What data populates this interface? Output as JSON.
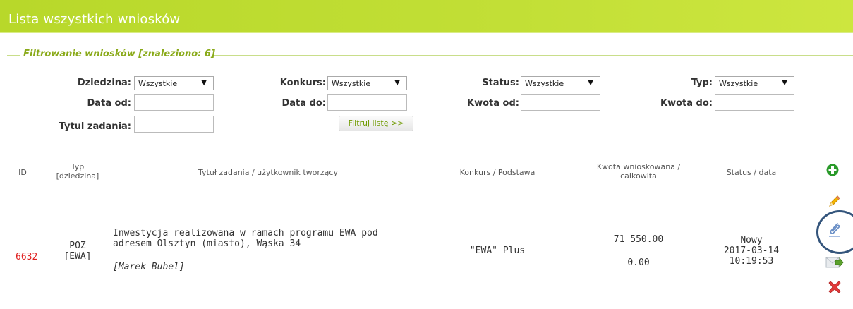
{
  "header": {
    "title": "Lista wszystkich wniosków"
  },
  "filter": {
    "legend": "Filtrowanie wniosków [znaleziono: 6]",
    "dziedzina_label": "Dziedzina:",
    "dziedzina_value": "Wszystkie",
    "konkurs_label": "Konkurs:",
    "konkurs_value": "Wszystkie",
    "status_label": "Status:",
    "status_value": "Wszystkie",
    "typ_label": "Typ:",
    "typ_value": "Wszystkie",
    "data_od_label": "Data od:",
    "data_do_label": "Data do:",
    "kwota_od_label": "Kwota od:",
    "kwota_do_label": "Kwota do:",
    "tytul_label": "Tytul zadania:",
    "filter_button": "Filtruj listę >>"
  },
  "table": {
    "headers": {
      "id": "ID",
      "typ_line1": "Typ",
      "typ_line2": "[dziedzina]",
      "tytul": "Tytuł zadania / użytkownik tworzący",
      "konkurs": "Konkurs / Podstawa",
      "kwota_line1": "Kwota wnioskowana /",
      "kwota_line2": "całkowita",
      "status": "Status / data"
    },
    "rows": [
      {
        "id": "6632",
        "typ_line1": "POZ",
        "typ_line2": "[EWA]",
        "title_line1": "Inwestycja realizowana w ramach programu EWA pod",
        "title_line2": "adresem Olsztyn (miasto), Wąska 34",
        "user": "[Marek Bubel]",
        "konkurs": "\"EWA\" Plus",
        "kwota_wnioskowana": "71 550.00",
        "kwota_calkowita": "0.00",
        "status": "Nowy",
        "date": "2017-03-14",
        "time": "10:19:53"
      }
    ]
  },
  "icons": {
    "add": "plus-icon",
    "edit": "pencil-icon",
    "attach": "paperclip-icon",
    "send": "send-icon",
    "delete": "delete-icon"
  },
  "colors": {
    "accent": "#b8d82a",
    "id_red": "#e02020",
    "legend": "#8aaa1a"
  }
}
